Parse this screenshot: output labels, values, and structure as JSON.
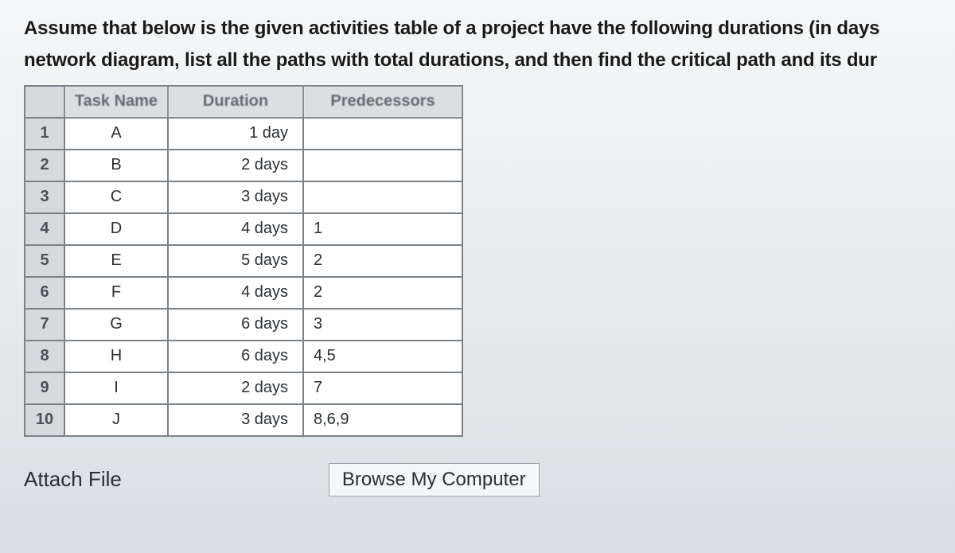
{
  "question": {
    "line1": "Assume that below is the given activities table of a project have the following durations (in days",
    "line2": "network diagram, list all the paths with total durations, and then find the critical path and its dur"
  },
  "table": {
    "headers": {
      "corner": "",
      "task": "Task Name",
      "duration": "Duration",
      "predecessors": "Predecessors"
    },
    "rows": [
      {
        "id": "1",
        "task": "A",
        "duration": "1 day",
        "predecessors": ""
      },
      {
        "id": "2",
        "task": "B",
        "duration": "2 days",
        "predecessors": ""
      },
      {
        "id": "3",
        "task": "C",
        "duration": "3 days",
        "predecessors": ""
      },
      {
        "id": "4",
        "task": "D",
        "duration": "4 days",
        "predecessors": "1"
      },
      {
        "id": "5",
        "task": "E",
        "duration": "5 days",
        "predecessors": "2"
      },
      {
        "id": "6",
        "task": "F",
        "duration": "4 days",
        "predecessors": "2"
      },
      {
        "id": "7",
        "task": "G",
        "duration": "6 days",
        "predecessors": "3"
      },
      {
        "id": "8",
        "task": "H",
        "duration": "6 days",
        "predecessors": "4,5"
      },
      {
        "id": "9",
        "task": "I",
        "duration": "2 days",
        "predecessors": "7"
      },
      {
        "id": "10",
        "task": "J",
        "duration": "3 days",
        "predecessors": "8,6,9"
      }
    ]
  },
  "attach": {
    "label": "Attach File",
    "browse": "Browse My Computer"
  }
}
